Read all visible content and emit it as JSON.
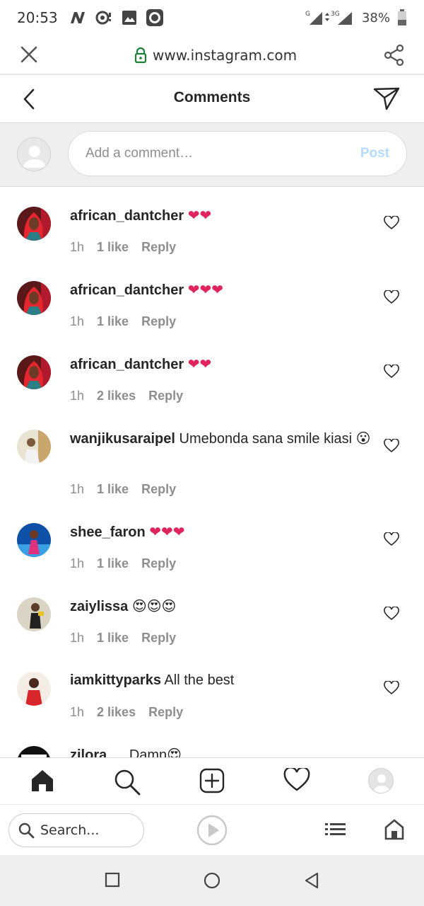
{
  "status_bar": {
    "time": "20:53",
    "network_1": "G",
    "network_2": "3G",
    "battery": "38%",
    "icons": [
      "n-notification-icon",
      "sync-icon",
      "image-icon",
      "record-icon",
      "signal-icon",
      "battery-icon"
    ]
  },
  "browser": {
    "url": "www.instagram.com",
    "icons": [
      "close-icon",
      "lock-icon",
      "share-icon"
    ]
  },
  "header": {
    "title": "Comments",
    "icons": [
      "back-icon",
      "direct-send-icon"
    ]
  },
  "composer": {
    "placeholder": "Add a comment…",
    "post_label": "Post"
  },
  "comments": [
    {
      "user": "african_dantcher",
      "text": "",
      "emoji": "❤❤",
      "emoji_kind": "heart",
      "time": "1h",
      "likes": "1 like",
      "reply": "Reply"
    },
    {
      "user": "african_dantcher",
      "text": "",
      "emoji": "❤❤❤",
      "emoji_kind": "heart",
      "time": "1h",
      "likes": "1 like",
      "reply": "Reply"
    },
    {
      "user": "african_dantcher",
      "text": "",
      "emoji": "❤❤",
      "emoji_kind": "heart",
      "time": "1h",
      "likes": "2 likes",
      "reply": "Reply"
    },
    {
      "user": "wanjikusaraipel",
      "text": "Umebonda sana smile kiasi",
      "emoji": "😮",
      "emoji_kind": "face",
      "time": "1h",
      "likes": "1 like",
      "reply": "Reply"
    },
    {
      "user": "shee_faron",
      "text": "",
      "emoji": "❤❤❤",
      "emoji_kind": "heart",
      "time": "1h",
      "likes": "1 like",
      "reply": "Reply"
    },
    {
      "user": "zaiylissa",
      "text": "",
      "emoji": "😍😍😍",
      "emoji_kind": "face",
      "time": "1h",
      "likes": "1 like",
      "reply": "Reply"
    },
    {
      "user": "iamkittyparks",
      "text": "All the best",
      "emoji": "",
      "emoji_kind": "",
      "time": "1h",
      "likes": "2 likes",
      "reply": "Reply"
    },
    {
      "user": "zilora",
      "text": "Damn",
      "emoji": "😍",
      "emoji_kind": "face",
      "time": "",
      "likes": "",
      "reply": ""
    }
  ],
  "bottom_nav": [
    "home-icon",
    "search-icon",
    "new-post-icon",
    "activity-heart-icon",
    "profile-avatar"
  ],
  "browser_toolbar": {
    "search_label": "Search...",
    "icons": [
      "search-icon",
      "play-icon",
      "tabs-list-icon",
      "home-icon"
    ]
  },
  "system_nav": [
    "recents-square-icon",
    "home-circle-icon",
    "back-triangle-icon"
  ],
  "colors": {
    "accent_lock": "#1a7f37",
    "post_disabled": "#b3dbff",
    "heart_emoji": "#e0245e",
    "secondary_text": "#8e8e8e"
  }
}
